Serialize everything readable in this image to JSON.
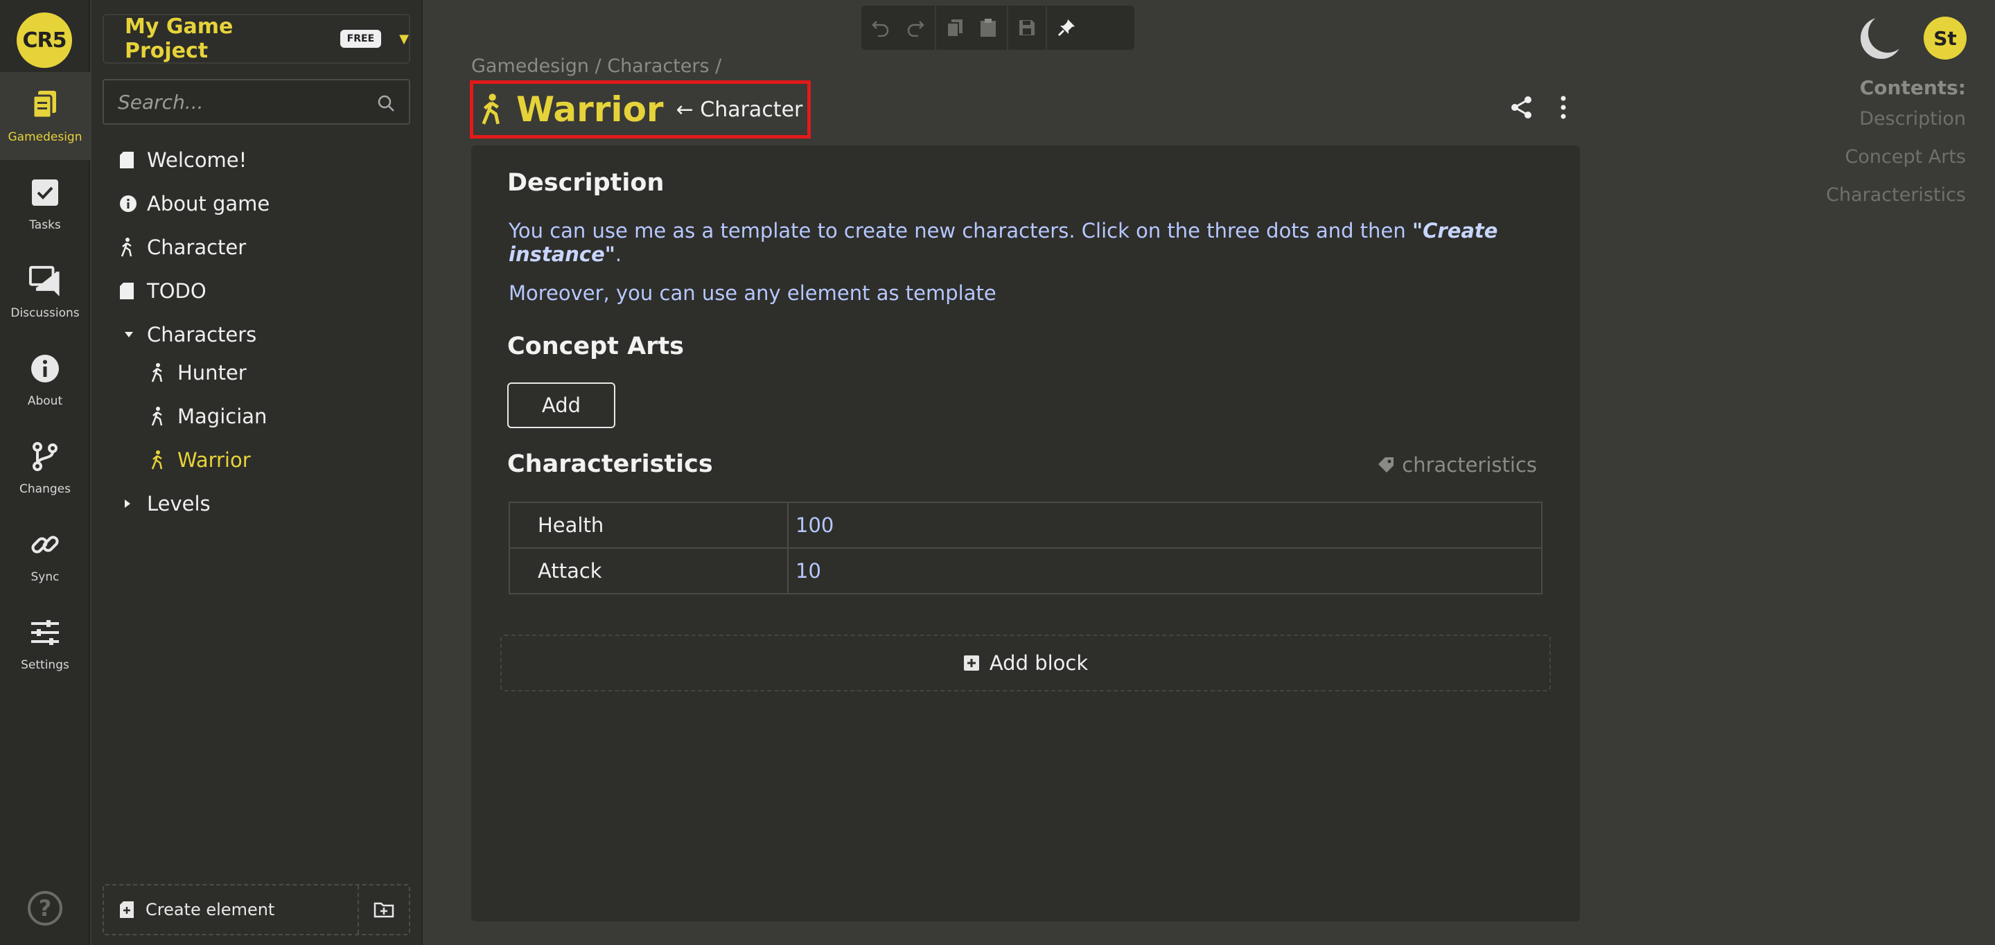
{
  "rail": {
    "logo": "CR5",
    "items": [
      {
        "label": "Gamedesign",
        "icon": "gamedesign-icon"
      },
      {
        "label": "Tasks",
        "icon": "tasks-icon"
      },
      {
        "label": "Discussions",
        "icon": "discussions-icon"
      },
      {
        "label": "About",
        "icon": "about-icon"
      },
      {
        "label": "Changes",
        "icon": "changes-icon"
      },
      {
        "label": "Sync",
        "icon": "sync-icon"
      },
      {
        "label": "Settings",
        "icon": "settings-icon"
      }
    ],
    "help": "?"
  },
  "nav": {
    "project_name": "My Game Project",
    "project_badge": "FREE",
    "search_placeholder": "Search...",
    "tree": [
      {
        "label": "Welcome!",
        "icon": "document-icon"
      },
      {
        "label": "About game",
        "icon": "info-icon"
      },
      {
        "label": "Character",
        "icon": "walking-person-icon"
      },
      {
        "label": "TODO",
        "icon": "document-icon"
      },
      {
        "label": "Characters",
        "icon": "caret-down-icon"
      },
      {
        "label": "Hunter",
        "icon": "walking-person-icon"
      },
      {
        "label": "Magician",
        "icon": "walking-person-icon"
      },
      {
        "label": "Warrior",
        "icon": "walking-person-icon"
      },
      {
        "label": "Levels",
        "icon": "caret-right-icon"
      }
    ],
    "create_element": "Create element"
  },
  "main": {
    "breadcrumb": "Gamedesign / Characters /",
    "title": "Warrior",
    "template_ref": "← Character",
    "sections": {
      "description": {
        "heading": "Description",
        "line1_prefix": "You can use me as a template to create new characters. Click on the three dots and then ",
        "line1_emphasis": "\"Create instance\"",
        "line1_suffix": ".",
        "line2": "Moreover, you can use any element as template"
      },
      "concept_arts": {
        "heading": "Concept Arts",
        "add_label": "Add"
      },
      "characteristics": {
        "heading": "Characteristics",
        "tag": "chracteristics",
        "rows": [
          {
            "key": "Health",
            "value": "100"
          },
          {
            "key": "Attack",
            "value": "10"
          }
        ]
      }
    },
    "add_block": "Add block"
  },
  "user": {
    "initials": "St"
  },
  "toc": {
    "title": "Contents:",
    "items": [
      "Description",
      "Concept Arts",
      "Characteristics"
    ]
  },
  "colors": {
    "accent": "#e6d33a",
    "highlight_border": "#e21a1a",
    "link_text": "#b6c8ff"
  }
}
